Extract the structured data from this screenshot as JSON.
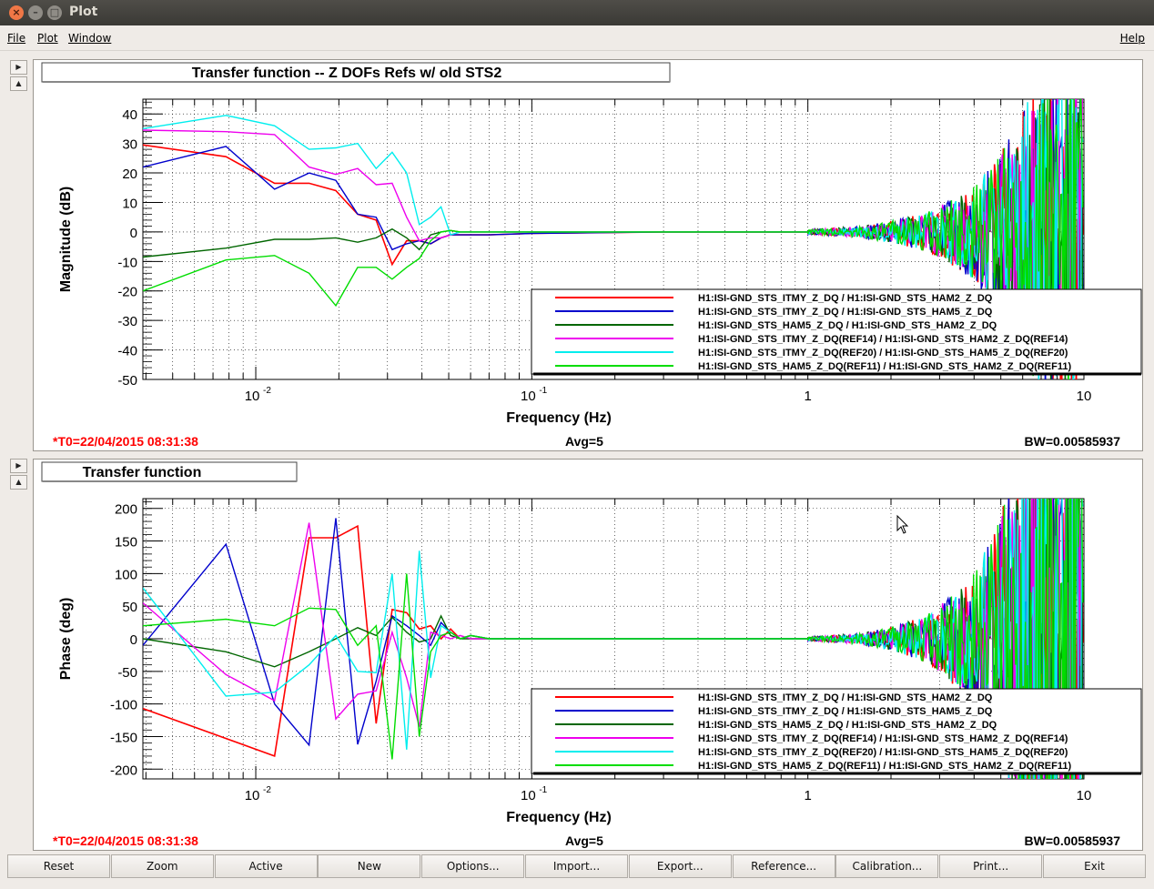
{
  "window": {
    "title": "Plot"
  },
  "menu": {
    "file": "File",
    "plot": "Plot",
    "window": "Window",
    "help": "Help"
  },
  "colors": {
    "red": "#ff0000",
    "blue": "#0000cc",
    "darkgreen": "#006600",
    "magenta": "#ee00ee",
    "cyan": "#00eeee",
    "green": "#00dd00"
  },
  "legend": [
    "H1:ISI-GND_STS_ITMY_Z_DQ / H1:ISI-GND_STS_HAM2_Z_DQ",
    "H1:ISI-GND_STS_ITMY_Z_DQ / H1:ISI-GND_STS_HAM5_Z_DQ",
    "H1:ISI-GND_STS_HAM5_Z_DQ / H1:ISI-GND_STS_HAM2_Z_DQ",
    "H1:ISI-GND_STS_ITMY_Z_DQ(REF14) / H1:ISI-GND_STS_HAM2_Z_DQ(REF14)",
    "H1:ISI-GND_STS_ITMY_Z_DQ(REF20) / H1:ISI-GND_STS_HAM5_Z_DQ(REF20)",
    "H1:ISI-GND_STS_HAM5_Z_DQ(REF11) / H1:ISI-GND_STS_HAM2_Z_DQ(REF11)"
  ],
  "footer": {
    "t0": "*T0=22/04/2015 08:31:38",
    "avg": "Avg=5",
    "bw": "BW=0.00585937"
  },
  "chart_data": [
    {
      "type": "line",
      "title": "Transfer function -- Z DOFs Refs w/ old STS2",
      "xlabel": "Frequency (Hz)",
      "ylabel": "Magnitude (dB)",
      "xscale": "log",
      "xlim": [
        0.0039,
        10
      ],
      "ylim": [
        -50,
        45
      ],
      "xticks": [
        0.01,
        0.1,
        1,
        10
      ],
      "xtick_labels": [
        "10",
        "10",
        "1",
        "10"
      ],
      "xtick_exponents": [
        "-2",
        "-1",
        "",
        ""
      ],
      "yticks": [
        40,
        30,
        20,
        10,
        0,
        -10,
        -20,
        -30,
        -40,
        -50
      ],
      "grid": true,
      "legend_position": "bottom-right",
      "series": [
        {
          "name": "H1:ISI-GND_STS_ITMY_Z_DQ / H1:ISI-GND_STS_HAM2_Z_DQ",
          "color": "#ff0000",
          "x": [
            0.0039,
            0.0078,
            0.0117,
            0.0156,
            0.0195,
            0.0234,
            0.0273,
            0.0312,
            0.0352,
            0.0391,
            0.043,
            0.0469,
            0.0508,
            0.055,
            0.06,
            0.07,
            0.1,
            0.3,
            1
          ],
          "y": [
            29.5,
            25.5,
            16.5,
            16.5,
            14,
            6,
            4,
            -11,
            -3,
            -3,
            -4,
            -2,
            -1,
            -1,
            -1,
            -1,
            -0.5,
            0,
            0
          ]
        },
        {
          "name": "H1:ISI-GND_STS_ITMY_Z_DQ / H1:ISI-GND_STS_HAM5_Z_DQ",
          "color": "#0000cc",
          "x": [
            0.0039,
            0.0078,
            0.0117,
            0.0156,
            0.0195,
            0.0234,
            0.0273,
            0.0312,
            0.0352,
            0.0391,
            0.043,
            0.0469,
            0.0508,
            0.055,
            0.06,
            0.07,
            0.1,
            0.3,
            1
          ],
          "y": [
            22,
            29,
            14.5,
            20,
            17.5,
            6,
            5,
            -6,
            -4,
            -3,
            -4,
            -2,
            -1,
            -1,
            -1,
            -1,
            -0.5,
            0,
            0
          ]
        },
        {
          "name": "H1:ISI-GND_STS_HAM5_Z_DQ / H1:ISI-GND_STS_HAM2_Z_DQ",
          "color": "#006600",
          "x": [
            0.0039,
            0.0078,
            0.0117,
            0.0156,
            0.0195,
            0.0234,
            0.0273,
            0.0312,
            0.0352,
            0.0391,
            0.043,
            0.0469,
            0.0508,
            0.055,
            0.06,
            0.07,
            0.1,
            0.3,
            1
          ],
          "y": [
            -8.5,
            -5.5,
            -2.5,
            -2.5,
            -2,
            -3.5,
            -2,
            1,
            -2,
            -6,
            -1,
            0,
            0.5,
            0,
            0,
            0,
            0,
            0,
            0
          ]
        },
        {
          "name": "H1:ISI-GND_STS_ITMY_Z_DQ(REF14) / H1:ISI-GND_STS_HAM2_Z_DQ(REF14)",
          "color": "#ee00ee",
          "x": [
            0.0039,
            0.0078,
            0.0117,
            0.0156,
            0.0195,
            0.0234,
            0.0273,
            0.0312,
            0.0352,
            0.0391,
            0.043,
            0.0469,
            0.0508,
            0.055,
            0.06,
            0.07,
            0.1,
            0.3,
            1
          ],
          "y": [
            34.5,
            34,
            33,
            22,
            19.5,
            21.5,
            16,
            16.5,
            5,
            -3,
            -2,
            -2,
            -1,
            0,
            0,
            0,
            0,
            0,
            0
          ]
        },
        {
          "name": "H1:ISI-GND_STS_ITMY_Z_DQ(REF20) / H1:ISI-GND_STS_HAM5_Z_DQ(REF20)",
          "color": "#00eeee",
          "x": [
            0.0039,
            0.0078,
            0.0117,
            0.0156,
            0.0195,
            0.0234,
            0.0273,
            0.0312,
            0.0352,
            0.0391,
            0.043,
            0.0469,
            0.0508,
            0.055,
            0.06,
            0.07,
            0.1,
            0.3,
            1
          ],
          "y": [
            35,
            39.5,
            36,
            28,
            28.5,
            30,
            21.5,
            27,
            20,
            2.5,
            5,
            8.5,
            -1,
            0,
            0,
            0,
            0,
            0,
            0
          ]
        },
        {
          "name": "H1:ISI-GND_STS_HAM5_Z_DQ(REF11) / H1:ISI-GND_STS_HAM2_Z_DQ(REF11)",
          "color": "#00dd00",
          "x": [
            0.0039,
            0.0078,
            0.0117,
            0.0156,
            0.0195,
            0.0234,
            0.0273,
            0.0312,
            0.0352,
            0.0391,
            0.043,
            0.0469,
            0.0508,
            0.055,
            0.06,
            0.07,
            0.1,
            0.3,
            1
          ],
          "y": [
            -20,
            -9.5,
            -8,
            -14,
            -25,
            -12,
            -12,
            -16,
            -12,
            -9,
            -3,
            0,
            0.5,
            0,
            0,
            0,
            0,
            0,
            0
          ]
        }
      ]
    },
    {
      "type": "line",
      "title": "Transfer function",
      "xlabel": "Frequency (Hz)",
      "ylabel": "Phase (deg)",
      "xscale": "log",
      "xlim": [
        0.0039,
        10
      ],
      "ylim": [
        -215,
        215
      ],
      "xticks": [
        0.01,
        0.1,
        1,
        10
      ],
      "xtick_labels": [
        "10",
        "10",
        "1",
        "10"
      ],
      "xtick_exponents": [
        "-2",
        "-1",
        "",
        ""
      ],
      "yticks": [
        200,
        150,
        100,
        50,
        0,
        -50,
        -100,
        -150,
        -200
      ],
      "grid": true,
      "legend_position": "bottom-right",
      "series": [
        {
          "name": "H1:ISI-GND_STS_ITMY_Z_DQ / H1:ISI-GND_STS_HAM2_Z_DQ",
          "color": "#ff0000",
          "x": [
            0.0039,
            0.0117,
            0.0156,
            0.0195,
            0.0234,
            0.0273,
            0.0312,
            0.0352,
            0.0391,
            0.043,
            0.0469,
            0.0508,
            0.055,
            0.06,
            0.07,
            0.1,
            0.3,
            1
          ],
          "y": [
            -107,
            -180,
            155,
            155,
            173,
            -130,
            45,
            40,
            15,
            20,
            0,
            15,
            0,
            5,
            0,
            0,
            0,
            0
          ]
        },
        {
          "name": "H1:ISI-GND_STS_ITMY_Z_DQ / H1:ISI-GND_STS_HAM5_Z_DQ",
          "color": "#0000cc",
          "x": [
            0.0039,
            0.0078,
            0.0117,
            0.0156,
            0.0195,
            0.0234,
            0.0273,
            0.0312,
            0.0352,
            0.0391,
            0.043,
            0.0469,
            0.0508,
            0.055,
            0.06,
            0.07,
            0.1,
            0.3,
            1
          ],
          "y": [
            -10,
            145,
            -100,
            -163,
            185,
            -162,
            -65,
            35,
            20,
            5,
            -10,
            25,
            10,
            0,
            5,
            0,
            0,
            0,
            0
          ]
        },
        {
          "name": "H1:ISI-GND_STS_HAM5_Z_DQ / H1:ISI-GND_STS_HAM2_Z_DQ",
          "color": "#006600",
          "x": [
            0.0039,
            0.0078,
            0.0117,
            0.0156,
            0.0195,
            0.0234,
            0.0273,
            0.0312,
            0.0352,
            0.0391,
            0.043,
            0.0469,
            0.0508,
            0.055,
            0.06,
            0.07,
            0.1,
            0.3,
            1
          ],
          "y": [
            0,
            -20,
            -43,
            -20,
            0,
            17,
            5,
            33,
            10,
            -5,
            0,
            35,
            5,
            0,
            0,
            0,
            0,
            0,
            0
          ]
        },
        {
          "name": "H1:ISI-GND_STS_ITMY_Z_DQ(REF14) / H1:ISI-GND_STS_HAM2_Z_DQ(REF14)",
          "color": "#ee00ee",
          "x": [
            0.0039,
            0.0078,
            0.0117,
            0.0156,
            0.0195,
            0.0234,
            0.0273,
            0.0312,
            0.0352,
            0.0391,
            0.043,
            0.0469,
            0.0508,
            0.055,
            0.06,
            0.07,
            0.1,
            0.3,
            1
          ],
          "y": [
            55,
            -55,
            -95,
            178,
            -123,
            -85,
            -80,
            10,
            -60,
            -135,
            10,
            5,
            0,
            5,
            0,
            0,
            0,
            0,
            0
          ]
        },
        {
          "name": "H1:ISI-GND_STS_ITMY_Z_DQ(REF20) / H1:ISI-GND_STS_HAM5_Z_DQ(REF20)",
          "color": "#00eeee",
          "x": [
            0.0039,
            0.0078,
            0.0117,
            0.0156,
            0.0195,
            0.0234,
            0.0273,
            0.0312,
            0.0352,
            0.0391,
            0.043,
            0.0469,
            0.0508,
            0.055,
            0.06,
            0.07,
            0.1,
            0.3,
            1
          ],
          "y": [
            78,
            -88,
            -82,
            -40,
            5,
            -50,
            -52,
            100,
            -170,
            135,
            -60,
            20,
            10,
            0,
            5,
            0,
            0,
            0,
            0
          ]
        },
        {
          "name": "H1:ISI-GND_STS_HAM5_Z_DQ(REF11) / H1:ISI-GND_STS_HAM2_Z_DQ(REF11)",
          "color": "#00dd00",
          "x": [
            0.0039,
            0.0078,
            0.0117,
            0.0156,
            0.0195,
            0.0234,
            0.0273,
            0.0312,
            0.0352,
            0.0391,
            0.043,
            0.0469,
            0.0508,
            0.055,
            0.06,
            0.07,
            0.1,
            0.3,
            1
          ],
          "y": [
            20,
            30,
            20,
            47,
            45,
            -10,
            20,
            -185,
            100,
            -150,
            -20,
            5,
            10,
            0,
            5,
            0,
            0,
            0,
            0
          ]
        }
      ]
    }
  ],
  "arrows": {
    "right": "▶",
    "up": "▲"
  },
  "toolbar": [
    "Reset",
    "Zoom",
    "Active",
    "New",
    "Options...",
    "Import...",
    "Export...",
    "Reference...",
    "Calibration...",
    "Print...",
    "Exit"
  ]
}
